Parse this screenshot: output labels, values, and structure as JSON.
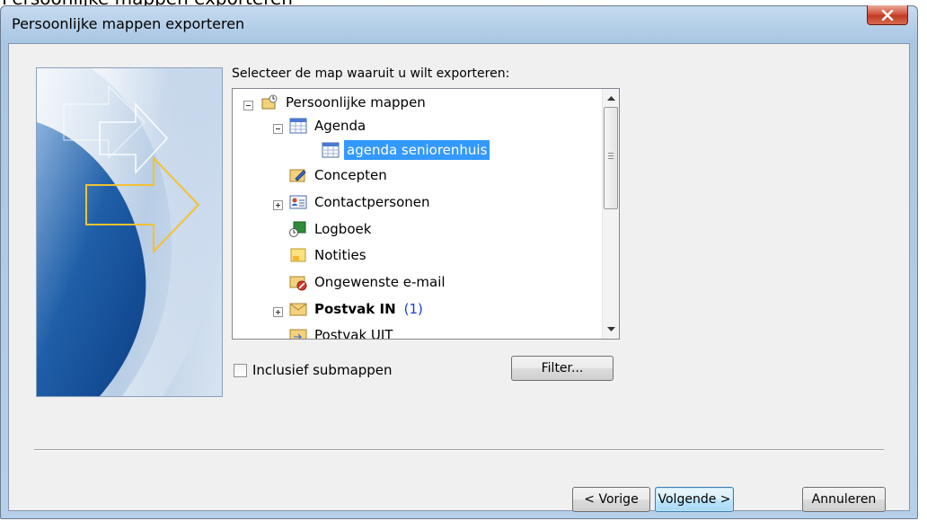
{
  "window": {
    "title": "Persoonlijke mappen exporteren",
    "close_label": "X"
  },
  "prompt": "Selecteer de map waaruit u wilt exporteren:",
  "tree": {
    "items": [
      {
        "label": "Persoonlijke mappen",
        "icon": "personal-folders-icon",
        "expander": "minus"
      },
      {
        "label": "Agenda",
        "icon": "calendar-icon",
        "expander": "minus"
      },
      {
        "label": "agenda seniorenhuis",
        "icon": "calendar-icon",
        "selected": true
      },
      {
        "label": "Concepten",
        "icon": "drafts-icon"
      },
      {
        "label": "Contactpersonen",
        "icon": "contacts-icon",
        "expander": "plus"
      },
      {
        "label": "Logboek",
        "icon": "journal-icon"
      },
      {
        "label": "Notities",
        "icon": "notes-icon"
      },
      {
        "label": "Ongewenste e-mail",
        "icon": "junk-mail-icon"
      },
      {
        "label": "Postvak IN",
        "icon": "inbox-icon",
        "expander": "plus",
        "bold": true,
        "count": "(1)"
      },
      {
        "label": "Postvak UIT",
        "icon": "outbox-icon"
      }
    ]
  },
  "include_subfolders": {
    "label": "Inclusief submappen",
    "checked": false
  },
  "buttons": {
    "filter": "Filter...",
    "back": "< Vorige",
    "next": "Volgende >",
    "cancel": "Annuleren"
  },
  "colors": {
    "selection": "#3399ff",
    "count": "#1c3fd8",
    "close_button": "#c94a33"
  }
}
